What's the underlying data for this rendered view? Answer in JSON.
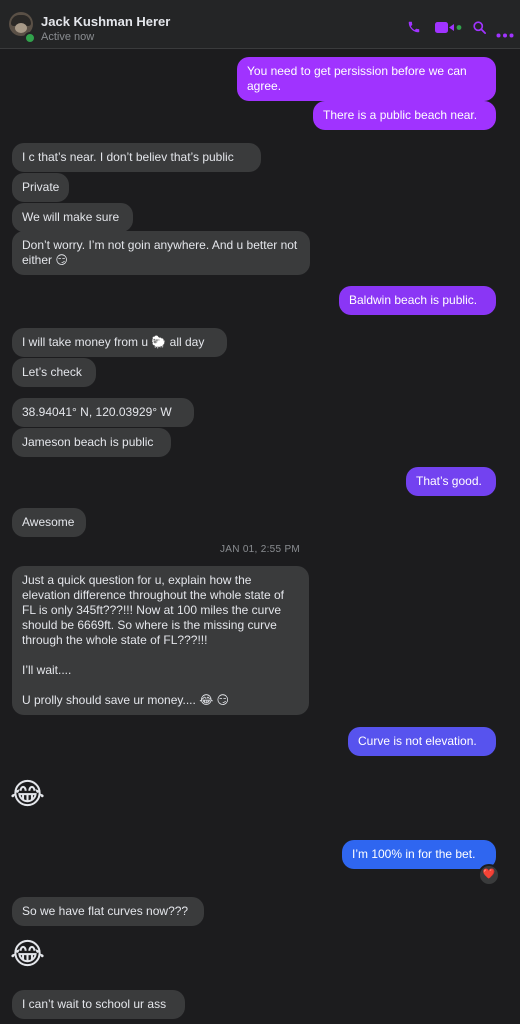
{
  "header": {
    "contact_name": "Jack Kushman Herer",
    "status": "Active now",
    "icons": [
      "phone-icon",
      "video-icon",
      "search-icon",
      "more-icon"
    ],
    "accent_color": "#a033ff"
  },
  "timestamp": "JAN 01, 2:55 PM",
  "messages": [
    {
      "from": "me",
      "text": "You need to get persission before we can agree."
    },
    {
      "from": "me",
      "text": "There is a public beach near."
    },
    {
      "from": "them",
      "text": "I c that’s near. I don’t believ that’s public"
    },
    {
      "from": "them",
      "text": "Private"
    },
    {
      "from": "them",
      "text": "We will make sure"
    },
    {
      "from": "them",
      "text": "Don’t worry. I’m not goin anywhere. And u better not either 😏"
    },
    {
      "from": "me",
      "text": "Baldwin beach is public."
    },
    {
      "from": "them",
      "text": "I will take money from u 🐑 all day"
    },
    {
      "from": "them",
      "text": "Let’s check"
    },
    {
      "from": "them",
      "text": "38.94041° N, 120.03929° W"
    },
    {
      "from": "them",
      "text": "Jameson beach is public"
    },
    {
      "from": "me",
      "text": "That’s good."
    },
    {
      "from": "them",
      "text": "Awesome"
    },
    {
      "from": "them",
      "text": "Just a quick question for u, explain how the elevation difference throughout the whole state of FL is only 345ft???!!! Now at 100 miles the curve should be 6669ft. So where is the missing curve through the whole state of FL???!!!\n\nI’ll wait....\n\nU prolly should save ur money.... 😂 😏"
    },
    {
      "from": "me",
      "text": "Curve is not elevation."
    },
    {
      "from": "them",
      "text": "😂",
      "emoji_only": true
    },
    {
      "from": "me",
      "text": "I’m 100% in for the bet.",
      "reaction": "❤️"
    },
    {
      "from": "them",
      "text": "So we have flat curves now???"
    },
    {
      "from": "them",
      "text": "😂",
      "emoji_only": true
    },
    {
      "from": "them",
      "text": "I can’t wait to school ur ass"
    }
  ]
}
